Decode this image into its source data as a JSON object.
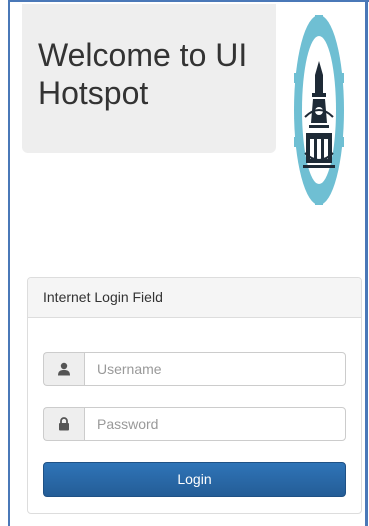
{
  "welcome": {
    "title": "Welcome to UI Hotspot"
  },
  "logo": {
    "icon": "university-seal-logo"
  },
  "login_panel": {
    "heading": "Internet Login Field",
    "username": {
      "placeholder": "Username",
      "value": "",
      "icon": "user-icon"
    },
    "password": {
      "placeholder": "Password",
      "value": "",
      "icon": "lock-icon"
    },
    "login_label": "Login"
  },
  "colors": {
    "frame": "#4a78b8",
    "button": "#2f74b8",
    "logo_teal": "#6fbfd3"
  }
}
